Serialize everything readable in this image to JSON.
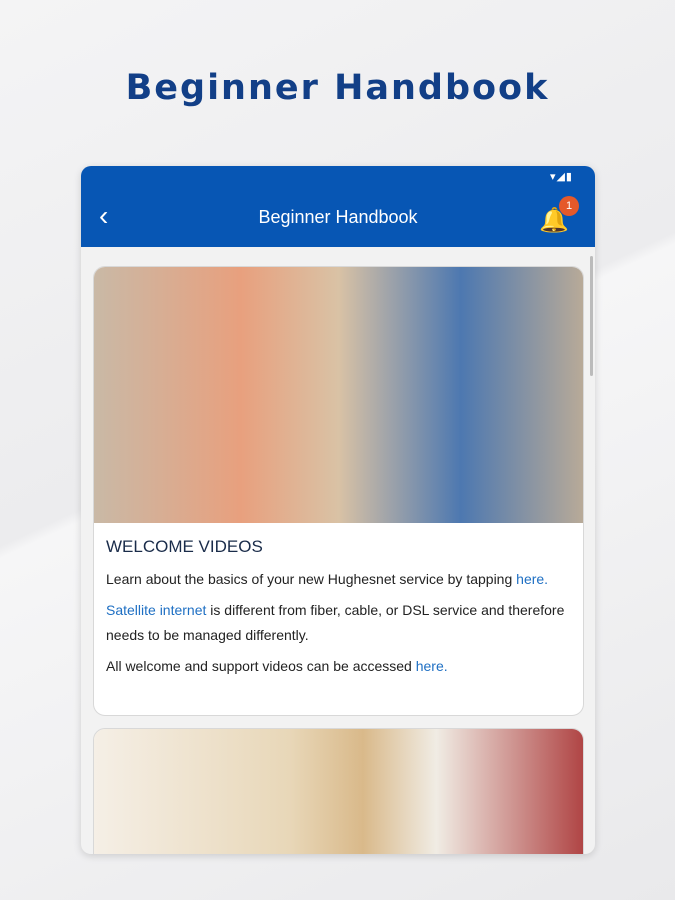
{
  "headline": "Beginner Handbook",
  "appbar": {
    "title": "Beginner Handbook",
    "status_icons": "▾◢▮",
    "notification_count": "1"
  },
  "card": {
    "heading": "WELCOME VIDEOS",
    "p1_text": "Learn about the basics of your new Hughesnet service by tapping ",
    "p1_link": "here.",
    "p2_link": "Satellite internet",
    "p2_text": " is different from fiber, cable, or DSL service and therefore needs to be managed differently.",
    "p3_text": "All welcome and support videos can be accessed ",
    "p3_link": "here."
  },
  "colors": {
    "brand": "#0756b4",
    "headline": "#123f87",
    "badge": "#e5592a",
    "link": "#1e6fc3"
  }
}
